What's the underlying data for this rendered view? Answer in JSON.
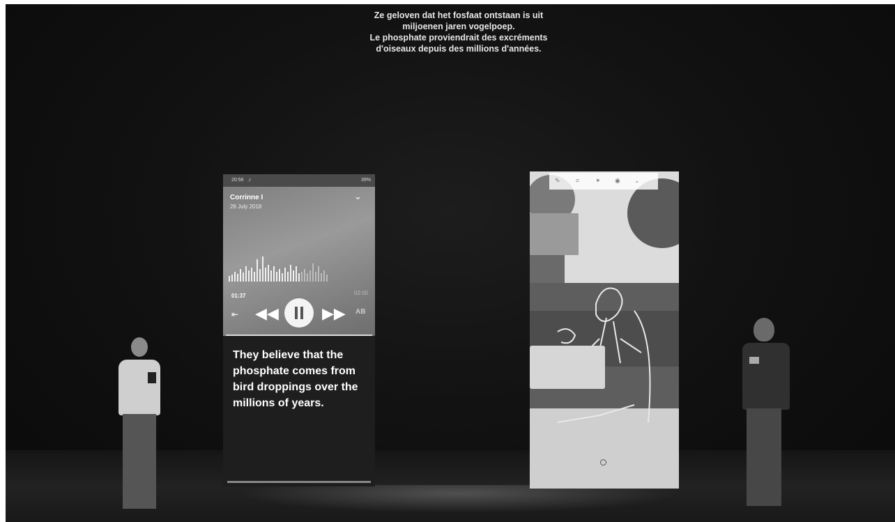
{
  "surtitles": {
    "dutch_line1": "Ze geloven dat het fosfaat ontstaan is uit",
    "dutch_line2": "miljoenen jaren vogelpoep.",
    "french_line1": "Le phosphate proviendrait des excréments",
    "french_line2": "d'oiseaux depuis des millions d'années."
  },
  "left_screen": {
    "status_time": "20:56",
    "status_battery": "39%",
    "track_title": "Corrinne I",
    "track_date": "26 July 2018",
    "time_current": "01:37",
    "time_total": "02:00",
    "ab_label": "AB",
    "progress_fraction": 0.8,
    "caption": "They believe that the phosphate comes from bird droppings over the millions of years.",
    "icons": [
      "music-note-icon",
      "chevron-down-icon",
      "skip-start-icon",
      "rewind-icon",
      "pause-icon",
      "fast-forward-icon"
    ]
  },
  "right_screen": {
    "icons": [
      "pen-icon",
      "crop-icon",
      "brightness-icon",
      "camera-icon",
      "chevron-down-icon",
      "shutter-icon"
    ]
  }
}
